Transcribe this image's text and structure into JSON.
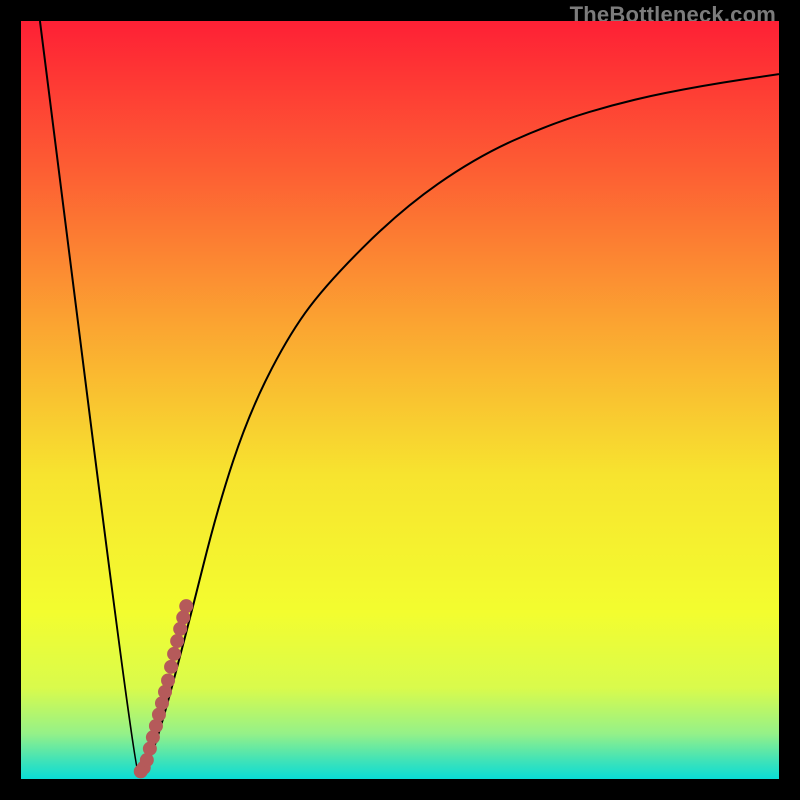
{
  "watermark": "TheBottleneck.com",
  "colors": {
    "frame": "#000000",
    "curve": "#000000",
    "marker": "#b55a5a",
    "gradient_stops": [
      {
        "offset": 0.0,
        "color": "#fe2035"
      },
      {
        "offset": 0.2,
        "color": "#fd5f33"
      },
      {
        "offset": 0.4,
        "color": "#fba431"
      },
      {
        "offset": 0.6,
        "color": "#f7e42f"
      },
      {
        "offset": 0.78,
        "color": "#f3fd2f"
      },
      {
        "offset": 0.88,
        "color": "#d9fb4c"
      },
      {
        "offset": 0.94,
        "color": "#95f188"
      },
      {
        "offset": 0.975,
        "color": "#41e3b7"
      },
      {
        "offset": 1.0,
        "color": "#0adcd6"
      }
    ]
  },
  "chart_data": {
    "type": "line",
    "title": "",
    "xlabel": "",
    "ylabel": "",
    "xlim": [
      0,
      100
    ],
    "ylim": [
      0,
      100
    ],
    "series": [
      {
        "name": "bottleneck-curve",
        "x": [
          2.5,
          15,
          16,
          18,
          22,
          26,
          30,
          35,
          40,
          50,
          60,
          70,
          80,
          90,
          100
        ],
        "y": [
          100,
          1,
          0.5,
          5,
          20,
          36,
          48,
          58,
          65,
          75,
          82,
          86.5,
          89.5,
          91.5,
          93
        ]
      }
    ],
    "markers": {
      "name": "highlight-segment",
      "x": [
        15.8,
        16.2,
        16.6,
        17.0,
        17.4,
        17.8,
        18.2,
        18.6,
        19.0,
        19.4,
        19.8,
        20.2,
        20.6,
        21.0,
        21.4,
        21.8
      ],
      "y": [
        1.0,
        1.5,
        2.5,
        4.0,
        5.5,
        7.0,
        8.5,
        10.0,
        11.5,
        13.0,
        14.8,
        16.5,
        18.2,
        19.8,
        21.3,
        22.8
      ]
    }
  }
}
